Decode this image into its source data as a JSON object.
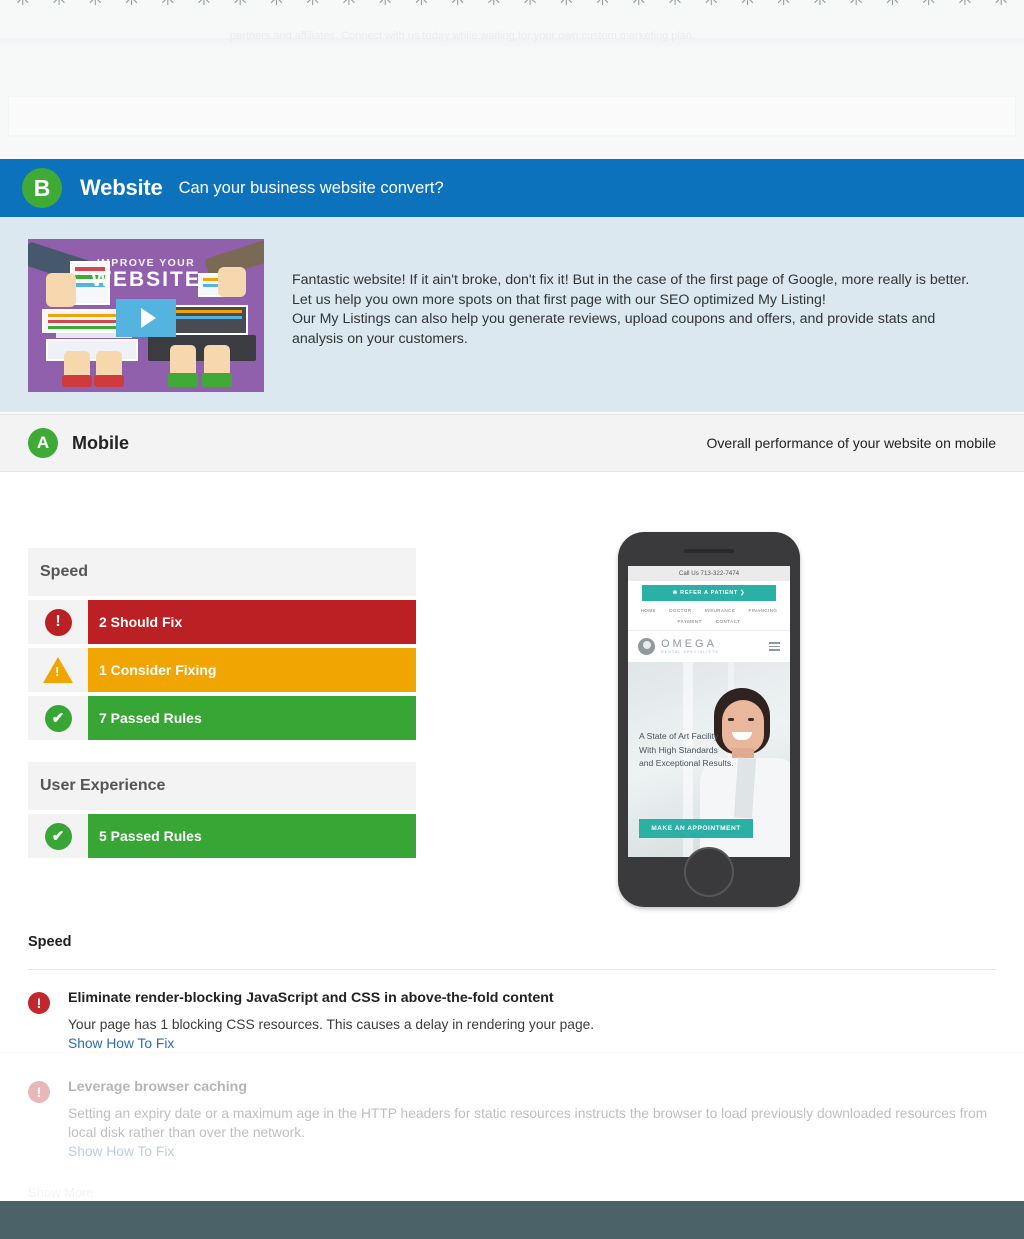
{
  "top_strip": {
    "sparkle_icon": "sparkle-icon",
    "sparkle_glyph": "✳",
    "sparkle_count": 28,
    "ghost_text": "partners and affiliates. Connect with us today while waiting for your own custom marketing plan."
  },
  "website_section": {
    "grade_badge": "B",
    "title": "Website",
    "subtitle": "Can your business website convert?",
    "header_color": "#0b72bb",
    "badge_color": "#3faa35",
    "body_bg": "#dce8f0",
    "video": {
      "name": "improve-your-website-video",
      "title_line1": "IMPROVE YOUR",
      "title_line2": "WEBSITE",
      "play_icon": "play-icon",
      "bg_color": "#9160ad"
    },
    "paragraphs": [
      "Fantastic website! If it ain't broke, don't fix it! But in the case of the first page of Google, more really is better.",
      "Let us help you own more spots on that first page with our SEO optimized My Listing!",
      "Our My Listings can also help you generate reviews, upload coupons and offers, and provide stats and",
      "analysis on your customers."
    ]
  },
  "mobile_section": {
    "grade_badge": "A",
    "title": "Mobile",
    "subtitle": "Overall performance of your website on mobile",
    "badge_color": "#3faa35",
    "header_bg": "#f3f3f3",
    "rule_groups": [
      {
        "name": "speed",
        "title": "Speed",
        "rules": [
          {
            "label": "2 Should Fix",
            "count": 2,
            "status": "should-fix",
            "color": "#bb2025",
            "icon": "error-circle-icon",
            "glyph": "!"
          },
          {
            "label": "1 Consider Fixing",
            "count": 1,
            "status": "consider-fixing",
            "color": "#f0a500",
            "icon": "warning-triangle-icon",
            "glyph": "!"
          },
          {
            "label": "7 Passed Rules",
            "count": 7,
            "status": "passed",
            "color": "#38a635",
            "icon": "check-circle-icon",
            "glyph": "✔"
          }
        ]
      },
      {
        "name": "user-experience",
        "title": "User Experience",
        "rules": [
          {
            "label": "5 Passed Rules",
            "count": 5,
            "status": "passed",
            "color": "#38a635",
            "icon": "check-circle-icon",
            "glyph": "✔"
          }
        ]
      }
    ],
    "phone_preview": {
      "name": "mobile-site-preview",
      "call_us": "Call Us 713-322-7474",
      "refer_button": "❀  REFER A PATIENT ❯",
      "nav_primary": [
        "HOME",
        "DOCTOR",
        "INSURANCE",
        "FINANCING"
      ],
      "nav_secondary": [
        "PAYMENT",
        "CONTACT"
      ],
      "logo_name": "OMEGA",
      "logo_tagline": "DENTAL SPECIALISTS",
      "menu_icon": "hamburger-menu-icon",
      "hero_headline_lines": [
        "A State of Art Facility",
        "With High Standards",
        "and Exceptional Results."
      ],
      "hero_cta": "MAKE AN APPOINTMENT",
      "accent_color": "#2bb0a6"
    }
  },
  "speed_detail": {
    "title": "Speed",
    "items": [
      {
        "icon": "error-circle-icon",
        "glyph": "!",
        "heading": "Eliminate render-blocking JavaScript and CSS in above-the-fold content",
        "body": "Your page has 1 blocking CSS resources. This causes a delay in rendering your page.",
        "link": "Show How To Fix",
        "faded": false
      },
      {
        "icon": "error-circle-icon",
        "glyph": "!",
        "heading": "Leverage browser caching",
        "body": "Setting an expiry date or a maximum age in the HTTP headers for static resources instructs the browser to load previously downloaded resources from local disk rather than over the network.",
        "link": "Show How To Fix",
        "faded": true
      }
    ]
  },
  "show_more_label": "Show More",
  "footer": {
    "color": "#4b6268"
  }
}
